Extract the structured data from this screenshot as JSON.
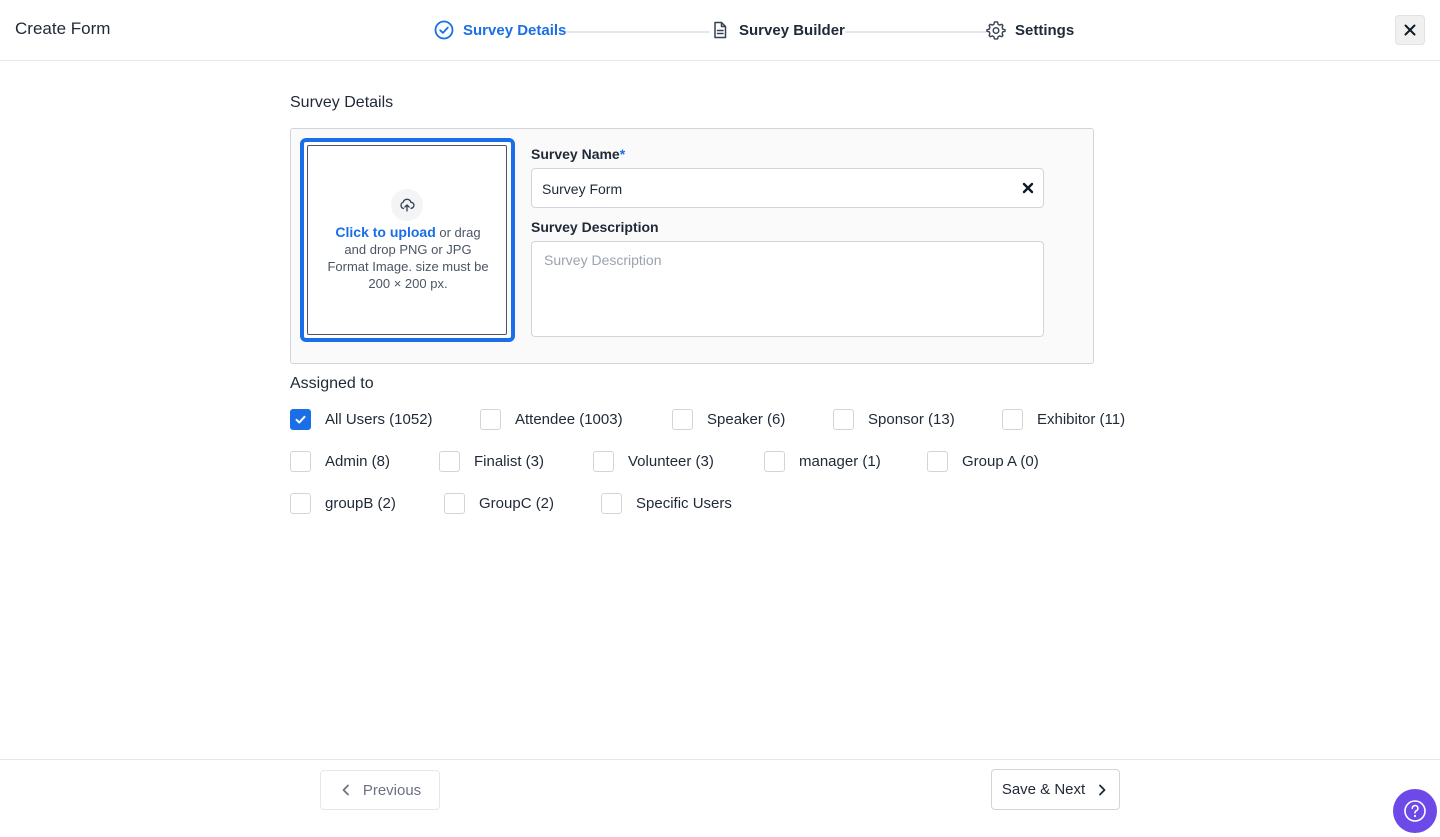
{
  "header": {
    "title": "Create Form",
    "steps": [
      {
        "label": "Survey Details",
        "icon": "check-circle-icon",
        "active": true
      },
      {
        "label": "Survey Builder",
        "icon": "document-icon",
        "active": false
      },
      {
        "label": "Settings",
        "icon": "gear-icon",
        "active": false
      }
    ],
    "close_icon": "close-icon"
  },
  "details": {
    "section_title": "Survey Details",
    "upload": {
      "icon": "upload-cloud-icon",
      "link_text": "Click to upload",
      "help_text": " or drag and drop PNG or JPG Format Image. size must be 200 × 200 px."
    },
    "name_label": "Survey Name",
    "required_mark": "*",
    "name_value": "Survey Form",
    "description_label": "Survey Description",
    "description_placeholder": "Survey Description",
    "description_value": ""
  },
  "assigned": {
    "title": "Assigned to",
    "rows": [
      [
        {
          "label": "All Users (1052)",
          "checked": true
        },
        {
          "label": "Attendee (1003)",
          "checked": false
        },
        {
          "label": "Speaker (6)",
          "checked": false
        },
        {
          "label": "Sponsor (13)",
          "checked": false
        },
        {
          "label": "Exhibitor (11)",
          "checked": false
        }
      ],
      [
        {
          "label": "Admin (8)",
          "checked": false
        },
        {
          "label": "Finalist (3)",
          "checked": false
        },
        {
          "label": "Volunteer (3)",
          "checked": false
        },
        {
          "label": "manager (1)",
          "checked": false
        },
        {
          "label": "Group A (0)",
          "checked": false
        }
      ],
      [
        {
          "label": "groupB (2)",
          "checked": false
        },
        {
          "label": "GroupC (2)",
          "checked": false
        },
        {
          "label": "Specific Users",
          "checked": false
        }
      ]
    ]
  },
  "footer": {
    "previous_label": "Previous",
    "next_label": "Save & Next",
    "help_icon": "help-icon"
  },
  "colors": {
    "accent": "#1a6fe8",
    "help_button": "#6d4ae8",
    "border": "#d1d5db"
  }
}
